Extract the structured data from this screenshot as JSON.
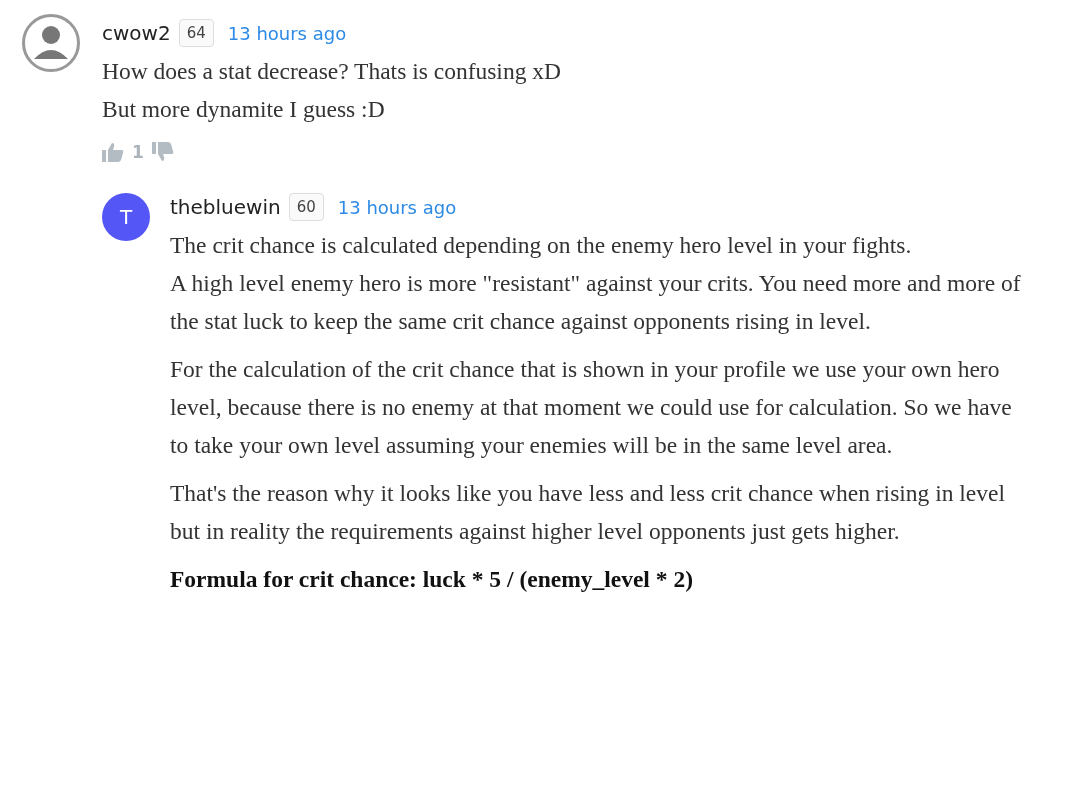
{
  "comments": [
    {
      "author": "cwow2",
      "avatar": {
        "kind": "silhouette"
      },
      "badge": "64",
      "time": "13 hours ago",
      "paragraphs": [
        {
          "kind": "plain",
          "lines": [
            "How does a stat decrease? Thats is confusing xD",
            "But more dynamite I guess :D"
          ]
        }
      ],
      "votes": {
        "up": "1"
      },
      "replies": [
        {
          "author": "thebluewin",
          "avatar": {
            "kind": "letter",
            "letter": "T",
            "color": "#5457f5"
          },
          "badge": "60",
          "time": "13 hours ago",
          "paragraphs": [
            {
              "kind": "plain",
              "lines": [
                "The crit chance is calculated depending on the enemy hero level in your fights.",
                "A high level enemy hero is more \"resistant\" against your crits. You need more and more of the stat luck to keep the same crit chance against opponents rising in level."
              ]
            },
            {
              "kind": "plain",
              "lines": [
                "For the calculation of the crit chance that is shown in your profile we use your own hero level, because there is no enemy at that moment we could use for calculation. So we have to take your own level assuming your enemies will be in the same level area."
              ]
            },
            {
              "kind": "plain",
              "lines": [
                "That's the reason why it looks like you have less and less crit chance when rising in level but in reality the requirements against higher level opponents just gets higher."
              ]
            },
            {
              "kind": "bold",
              "lines": [
                "Formula for crit chance: luck * 5 / (enemy_level * 2)"
              ]
            }
          ]
        }
      ]
    }
  ]
}
